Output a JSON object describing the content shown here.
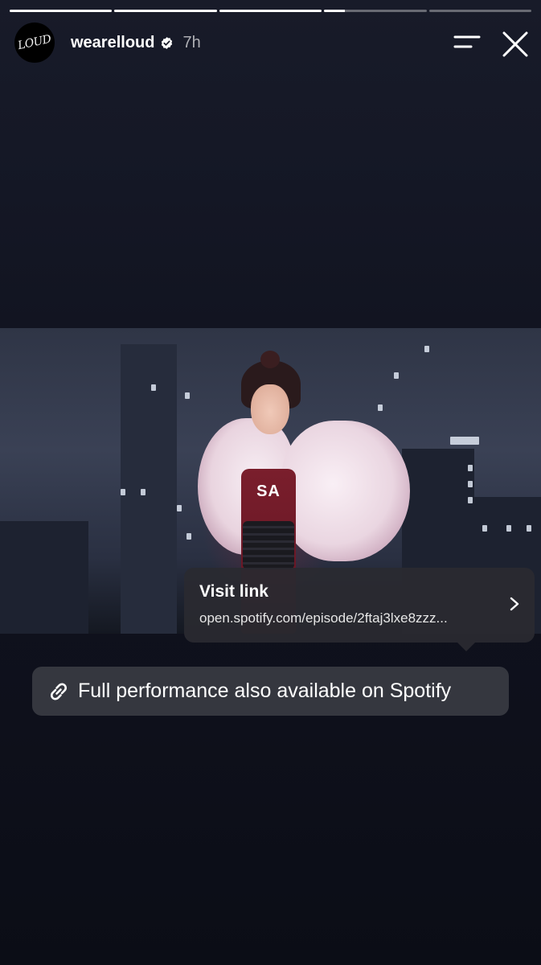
{
  "progress": {
    "segments": [
      {
        "fill": 1.0
      },
      {
        "fill": 1.0
      },
      {
        "fill": 1.0
      },
      {
        "fill": 0.2
      },
      {
        "fill": 0.0
      }
    ]
  },
  "header": {
    "avatar_text": "LOUD",
    "username": "wearelloud",
    "verified": true,
    "time": "7h"
  },
  "photo": {
    "shirt_text": "SA"
  },
  "link_tooltip": {
    "title": "Visit link",
    "url": "open.spotify.com/episode/2ftaj3lxe8zzz..."
  },
  "link_sticker": {
    "label": "Full performance also available on Spotify"
  },
  "colors": {
    "background": "#10121d",
    "tooltip_bg": "#2a2a30",
    "sticker_bg": "#3a3c44",
    "text": "#ffffff"
  },
  "icons": {
    "menu": "menu-icon",
    "close": "close-icon",
    "verified": "verified-badge-icon",
    "chevron": "chevron-right-icon",
    "link": "link-icon"
  }
}
